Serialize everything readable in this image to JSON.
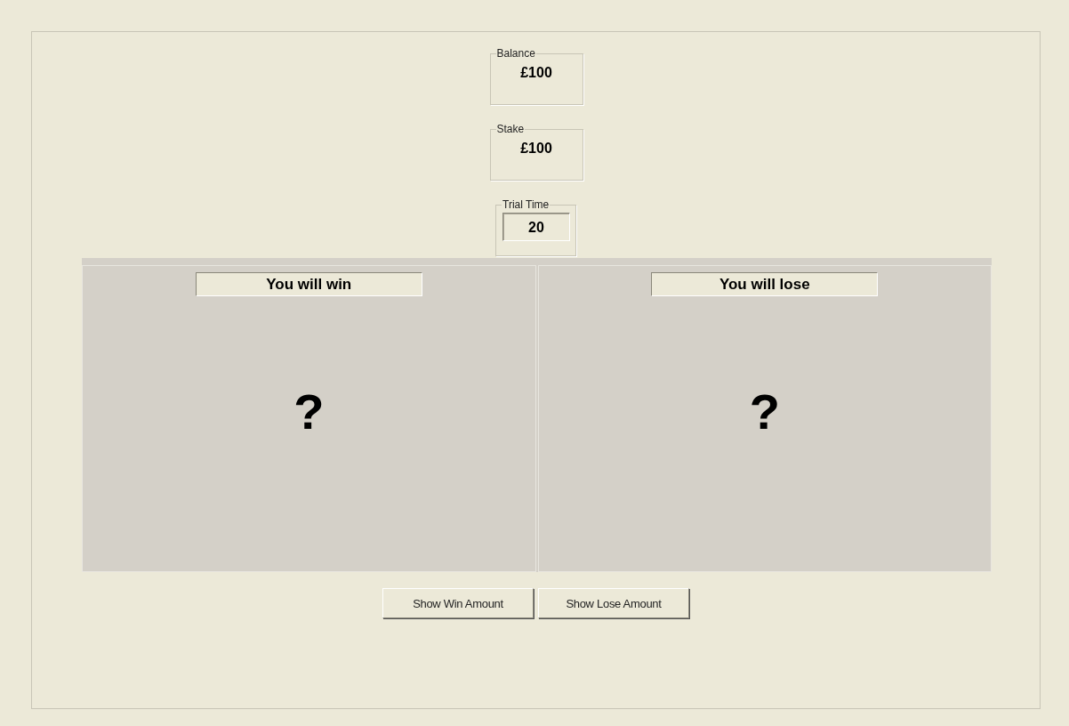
{
  "balance": {
    "label": "Balance",
    "value": "£100"
  },
  "stake": {
    "label": "Stake",
    "value": "£100"
  },
  "trial_time": {
    "label": "Trial Time",
    "value": "20"
  },
  "panels": [
    {
      "title": "You will win",
      "content": "?"
    },
    {
      "title": "You will lose",
      "content": "?"
    }
  ],
  "buttons": [
    "Show Win Amount",
    "Show Lose Amount"
  ]
}
